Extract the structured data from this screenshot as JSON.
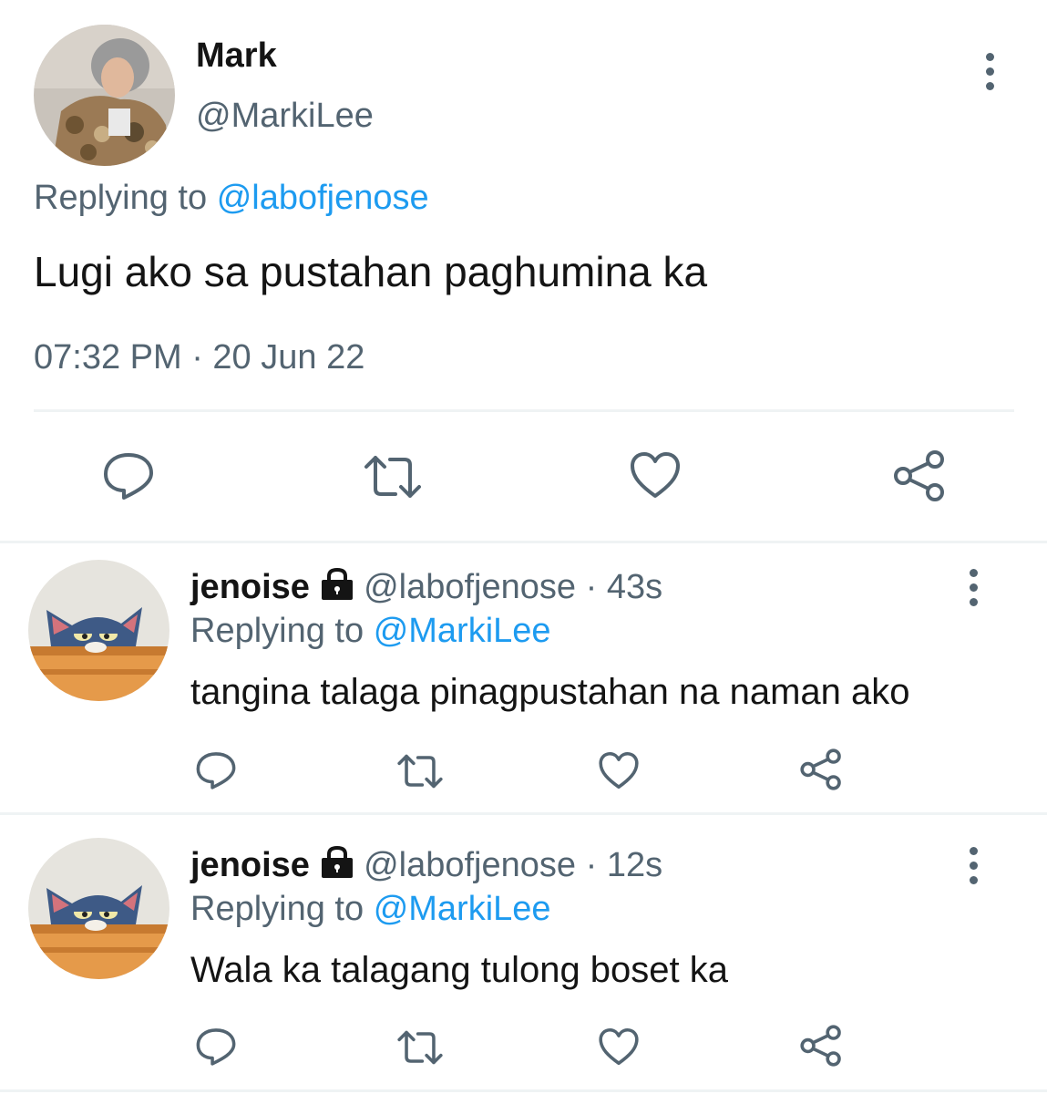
{
  "main_tweet": {
    "display_name": "Mark",
    "handle": "@MarkiLee",
    "replying_prefix": "Replying to",
    "replying_to": "@labofjenose",
    "text": "Lugi ako sa pustahan paghumina ka",
    "timestamp": "07:32 PM · 20 Jun 22"
  },
  "replies": [
    {
      "display_name": "jenoise",
      "handle": "@labofjenose",
      "age": "· 43s",
      "replying_prefix": "Replying to",
      "replying_to": "@MarkiLee",
      "text": "tangina talaga pinagpustahan na naman ako"
    },
    {
      "display_name": "jenoise",
      "handle": "@labofjenose",
      "age": "· 12s",
      "replying_prefix": "Replying to",
      "replying_to": "@MarkiLee",
      "text": "Wala ka talagang tulong boset ka"
    }
  ],
  "colors": {
    "link": "#1d9bf0",
    "muted": "#536471",
    "divider": "#eff3f4"
  },
  "icons": [
    "more-vertical-icon",
    "reply-icon",
    "retweet-icon",
    "like-icon",
    "share-icon",
    "lock-icon"
  ]
}
